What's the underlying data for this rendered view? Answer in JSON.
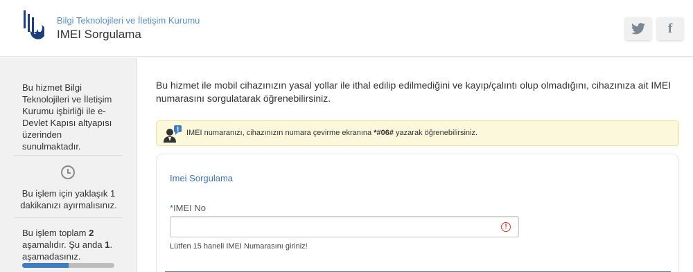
{
  "header": {
    "organization": "Bilgi Teknolojileri ve İletişim Kurumu",
    "service_title": "IMEI Sorgulama",
    "social": [
      "twitter-icon",
      "facebook-icon"
    ],
    "facebook_glyph": "f"
  },
  "sidebar": {
    "info": "Bu hizmet Bilgi Teknolojileri ve İletişim Kurumu işbirliği ile e-Devlet Kapısı altyapısı üzerinden sunulmaktadır.",
    "time_note": "Bu işlem için yaklaşık 1 dakikanızı ayırmalısınız.",
    "steps": {
      "text_before_total": "Bu işlem toplam ",
      "total": "2",
      "text_between": " aşamalıdır. Şu anda ",
      "current": "1",
      "text_after": ". aşamadasınız.",
      "progress_fraction": 0.5
    }
  },
  "main": {
    "intro": "Bu hizmet ile mobil cihazınızın yasal yollar ile ithal edilip edilmediğini ve kayıp/çalıntı olup olmadığını, cihazınıza ait IMEI numarasını sorgulatarak öğrenebilirsiniz.",
    "notice": {
      "text_before": "IMEI numaranızı, cihazınızın numara çevirme ekranına ",
      "code": "*#06#",
      "text_after": " yazarak öğrenebilirsiniz."
    },
    "form": {
      "title": "Imei Sorgulama",
      "required_mark": "*",
      "imei_label": "IMEI No",
      "imei_value": "",
      "error_glyph": "!",
      "hint": "Lütfen 15 haneli IMEI Numarasını giriniz!"
    }
  },
  "colors": {
    "accent": "#3b73ad",
    "org_text": "#5b8ec3",
    "progress_fill": "#3f7dc2",
    "notice_bg": "#fcf8dc",
    "error": "#d0392f"
  }
}
